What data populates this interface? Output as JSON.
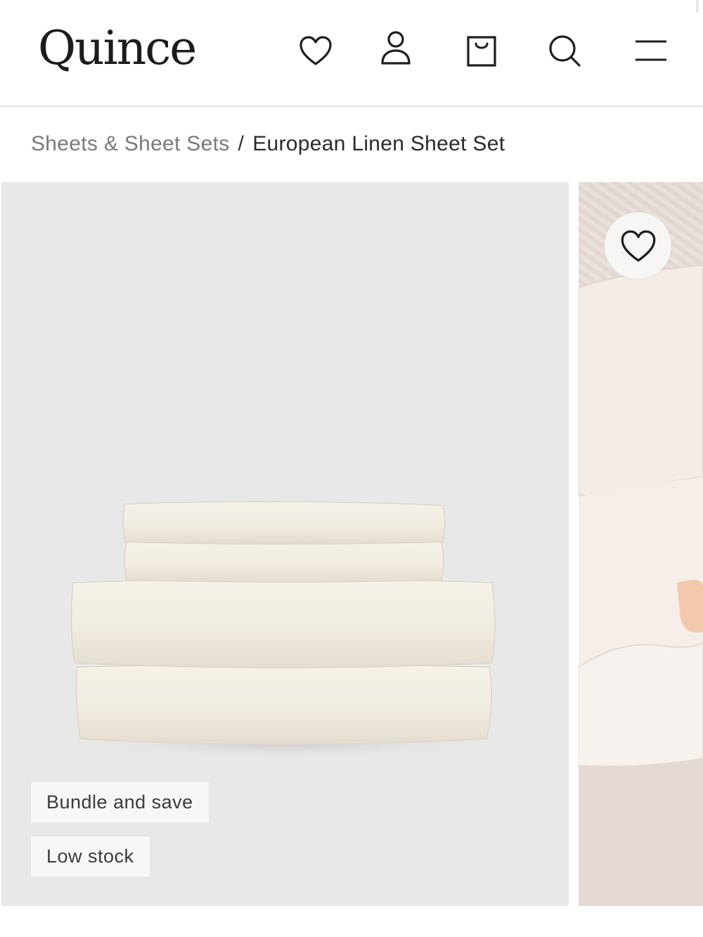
{
  "header": {
    "logo": "Quince",
    "icons": [
      "heart-icon",
      "account-icon",
      "bag-icon",
      "search-icon",
      "menu-icon"
    ]
  },
  "breadcrumb": {
    "parent": "Sheets & Sheet Sets",
    "separator": "/",
    "current": "European Linen Sheet Set"
  },
  "product_gallery": {
    "badges": [
      "Bundle and save",
      "Low stock"
    ],
    "product_color": "#f3efe4",
    "background_color": "#e8e8e8"
  }
}
